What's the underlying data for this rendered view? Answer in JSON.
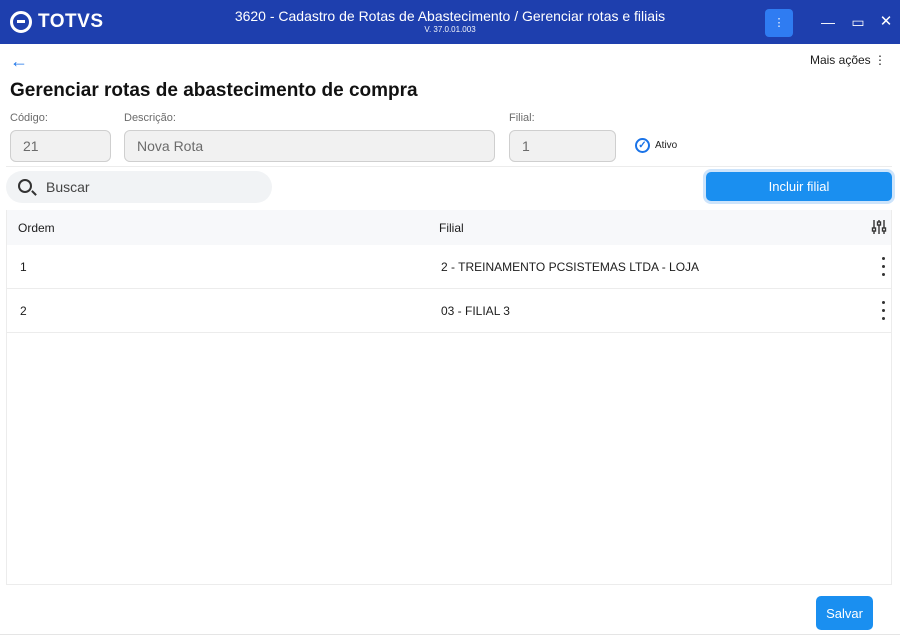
{
  "window": {
    "logo_text": "TOTVS",
    "title": "3620 - Cadastro de Rotas de Abastecimento / Gerenciar rotas e filiais",
    "version": "V. 37.0.01.003",
    "menu_glyph": "⋮",
    "min_glyph": "—",
    "max_glyph": "▭",
    "close_glyph": "✕"
  },
  "header": {
    "back_glyph": "←",
    "more_actions": "Mais ações ⋮",
    "page_title": "Gerenciar rotas de abastecimento de compra"
  },
  "form": {
    "codigo_label": "Código:",
    "codigo_value": "21",
    "descricao_label": "Descrição:",
    "descricao_value": "Nova Rota",
    "filial_label": "Filial:",
    "filial_value": "1",
    "ativo_label": "Ativo",
    "ativo_checked": true
  },
  "search": {
    "placeholder": "Buscar"
  },
  "actions": {
    "add_branch": "Incluir filial",
    "save": "Salvar"
  },
  "table": {
    "columns": [
      "Ordem",
      "Filial"
    ],
    "rows": [
      {
        "ordem": "1",
        "filial": "2 - TREINAMENTO PCSISTEMAS LTDA - LOJA"
      },
      {
        "ordem": "2",
        "filial": "03 - FILIAL 3"
      }
    ]
  },
  "colors": {
    "titlebar": "#1e3fae",
    "primary": "#1a8ff0",
    "accent": "#1a73e8"
  }
}
